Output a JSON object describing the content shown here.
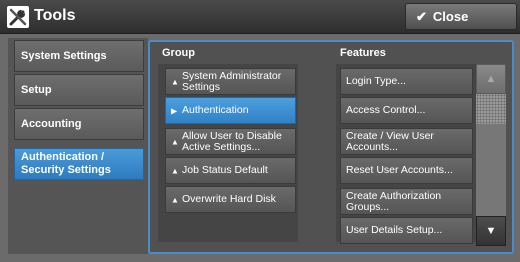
{
  "title": {
    "text": "Tools",
    "icon": "tools-icon"
  },
  "close_button": {
    "label": "Close",
    "icon": "check-icon"
  },
  "nav": {
    "items": [
      {
        "label": "System Settings",
        "active": false
      },
      {
        "label": "Setup",
        "active": false
      },
      {
        "label": "Accounting",
        "active": false
      },
      {
        "label": "Authentication / Security Settings",
        "active": true
      }
    ]
  },
  "group": {
    "header": "Group",
    "items": [
      {
        "label": "System Administrator Settings",
        "selected": false
      },
      {
        "label": "Authentication",
        "selected": true
      },
      {
        "label": "Allow User to Disable Active Settings...",
        "selected": false
      },
      {
        "label": "Job Status Default",
        "selected": false
      },
      {
        "label": "Overwrite Hard Disk",
        "selected": false
      }
    ]
  },
  "features": {
    "header": "Features",
    "items": [
      {
        "label": "Login Type..."
      },
      {
        "label": "Access Control..."
      },
      {
        "label": "Create / View User Accounts..."
      },
      {
        "label": "Reset User Accounts..."
      },
      {
        "label": "Create Authorization Groups..."
      },
      {
        "label": "User Details Setup..."
      }
    ]
  },
  "colors": {
    "accent": "#3a8ad0",
    "background": "#6b6b6b"
  }
}
